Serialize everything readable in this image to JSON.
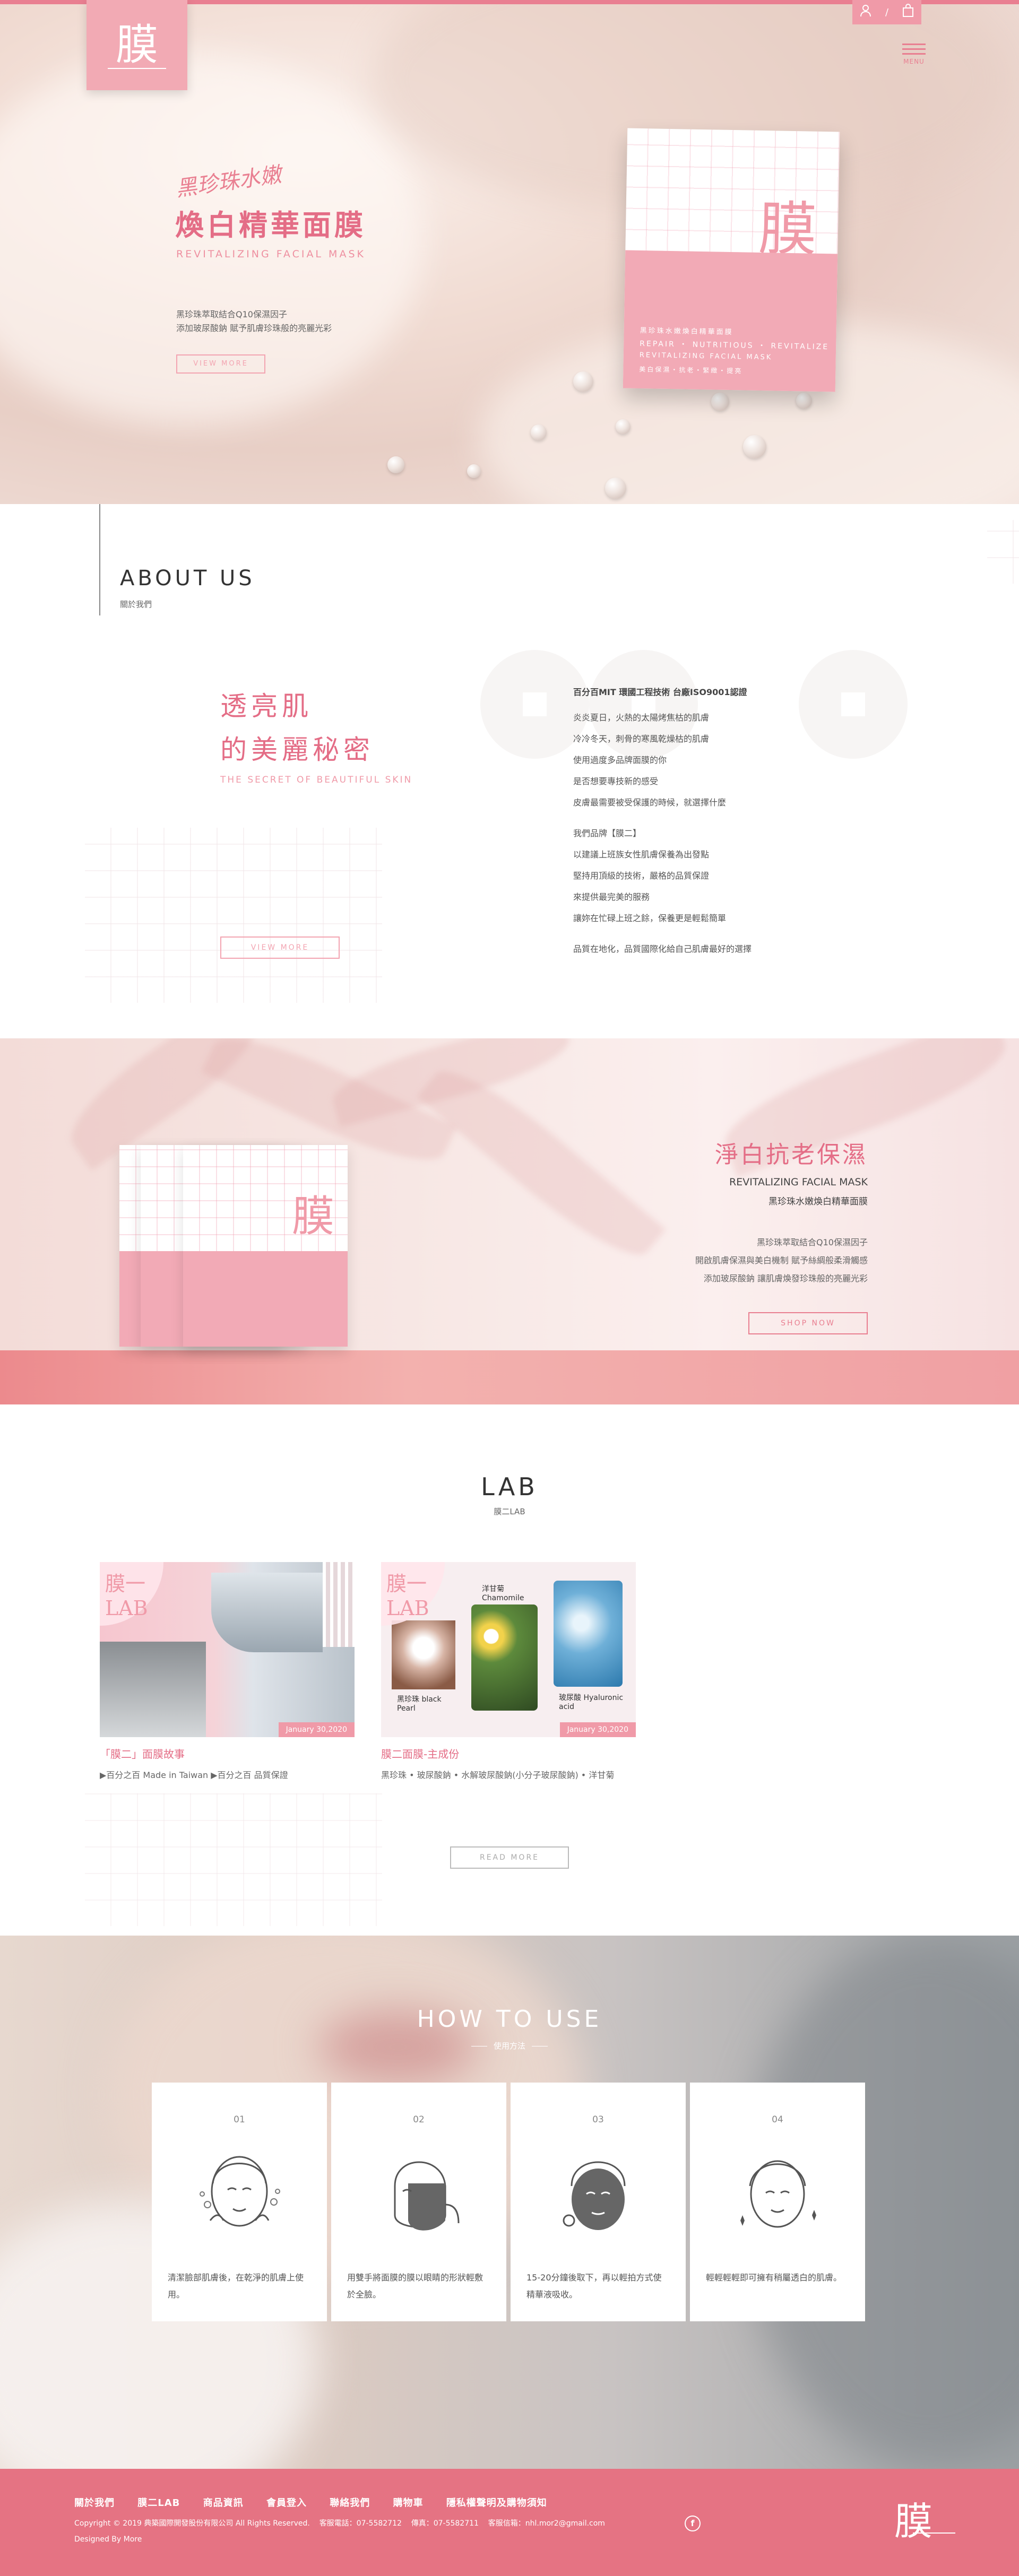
{
  "brand": {
    "logo_glyph": "膜",
    "accent": "#e97f91"
  },
  "header": {
    "menu_label": "MENU",
    "user_icon": "user-icon",
    "cart_icon": "cart-icon"
  },
  "hero": {
    "script": "黑珍珠水嫩",
    "title": "煥白精華面膜",
    "subtitle": "REVITALIZING FACIAL MASK",
    "desc_1": "黑珍珠萃取結合Q10保濕因子",
    "desc_2": "添加玻尿酸鈉 賦予肌膚珍珠般的亮麗光彩",
    "view_more": "VIEW MORE",
    "pack_line_1": "黑珍珠水嫩煥白精華面膜",
    "pack_line_2": "REPAIR ・ NUTRITIOUS ・ REVITALIZE",
    "pack_line_3": "REVITALIZING FACIAL MASK",
    "pack_line_4": "美白保濕・抗老・緊緻・提亮"
  },
  "about": {
    "title": "ABOUT US",
    "subtitle": "關於我們",
    "headline_1": "透亮肌",
    "headline_2": "的美麗秘密",
    "headline_en": "THE SECRET OF BEAUTIFUL SKIN",
    "view_more": "VIEW MORE",
    "para_bold": "百分百MIT 環國工程技術 台廠ISO9001認證",
    "lines_a": [
      "炎炎夏日，火熱的太陽烤焦枯的肌膚",
      "冷冷冬天，刺骨的寒風乾燥枯的肌膚",
      "使用過度多品牌面膜的你",
      "是否想要專技新的感受",
      "皮膚最需要被受保護的時候，就選擇什麼"
    ],
    "lines_b": [
      "我們品牌【膜二】",
      "以建議上班族女性肌膚保養為出發點",
      "堅持用頂級的技術，嚴格的品質保證",
      "來提供最完美的服務",
      "讓妳在忙碌上班之餘，保養更是輕鬆簡單"
    ],
    "closing": "品質在地化，品質國際化給自己肌膚最好的選擇"
  },
  "product_band": {
    "title": "淨白抗老保濕",
    "en": "REVITALIZING FACIAL MASK",
    "cn": "黑珍珠水嫩煥白精華面膜",
    "desc": [
      "黑珍珠萃取結合Q10保濕因子",
      "開啟肌膚保濕與美白機制 賦予絲綢般柔滑觸感",
      "添加玻尿酸鈉 讓肌膚煥發珍珠般的亮麗光彩"
    ],
    "shop_now": "SHOP NOW"
  },
  "lab": {
    "title": "LAB",
    "subtitle": "膜二LAB",
    "cards": [
      {
        "tag": "膜一LAB",
        "date": "January 30,2020",
        "heading": "「膜二」面膜故事",
        "desc": "▶百分之百  Made in Taiwan      ▶百分之百  品質保證"
      },
      {
        "tag": "膜一LAB",
        "date": "January 30,2020",
        "heading": "膜二面膜-主成份",
        "desc": "黑珍珠 • 玻尿酸鈉 • 水解玻尿酸鈉(小分子玻尿酸鈉) • 洋甘菊",
        "labels": [
          "黑珍珠 black Pearl",
          "洋甘菊 Chamomile",
          "玻尿酸 Hyaluronic acid"
        ]
      }
    ],
    "read_more": "READ MORE"
  },
  "howto": {
    "title": "HOW TO USE",
    "subtitle": "使用方法",
    "steps": [
      {
        "num": "01",
        "text": "清潔臉部肌膚後，在乾淨的肌膚上使用。"
      },
      {
        "num": "02",
        "text": "用雙手將面膜的膜以眼睛的形狀輕敷於全臉。"
      },
      {
        "num": "03",
        "text": "15-20分鐘後取下，再以輕拍方式使精華液吸收。"
      },
      {
        "num": "04",
        "text": "輕輕輕輕即可擁有稍屬透白的肌膚。"
      }
    ]
  },
  "footer": {
    "nav": [
      "關於我們",
      "膜二LAB",
      "商品資訊",
      "會員登入",
      "聯絡我們",
      "購物車",
      "隱私權聲明及購物須知"
    ],
    "copyright": "Copyright © 2019 典築國際開發股份有限公司 All Rights Reserved.",
    "phone": "客服電話：07-5582712",
    "fax": "傳真：07-5582711",
    "email": "客服信箱：nhl.mor2@gmail.com",
    "designed": "Designed By More",
    "fb": "f"
  }
}
